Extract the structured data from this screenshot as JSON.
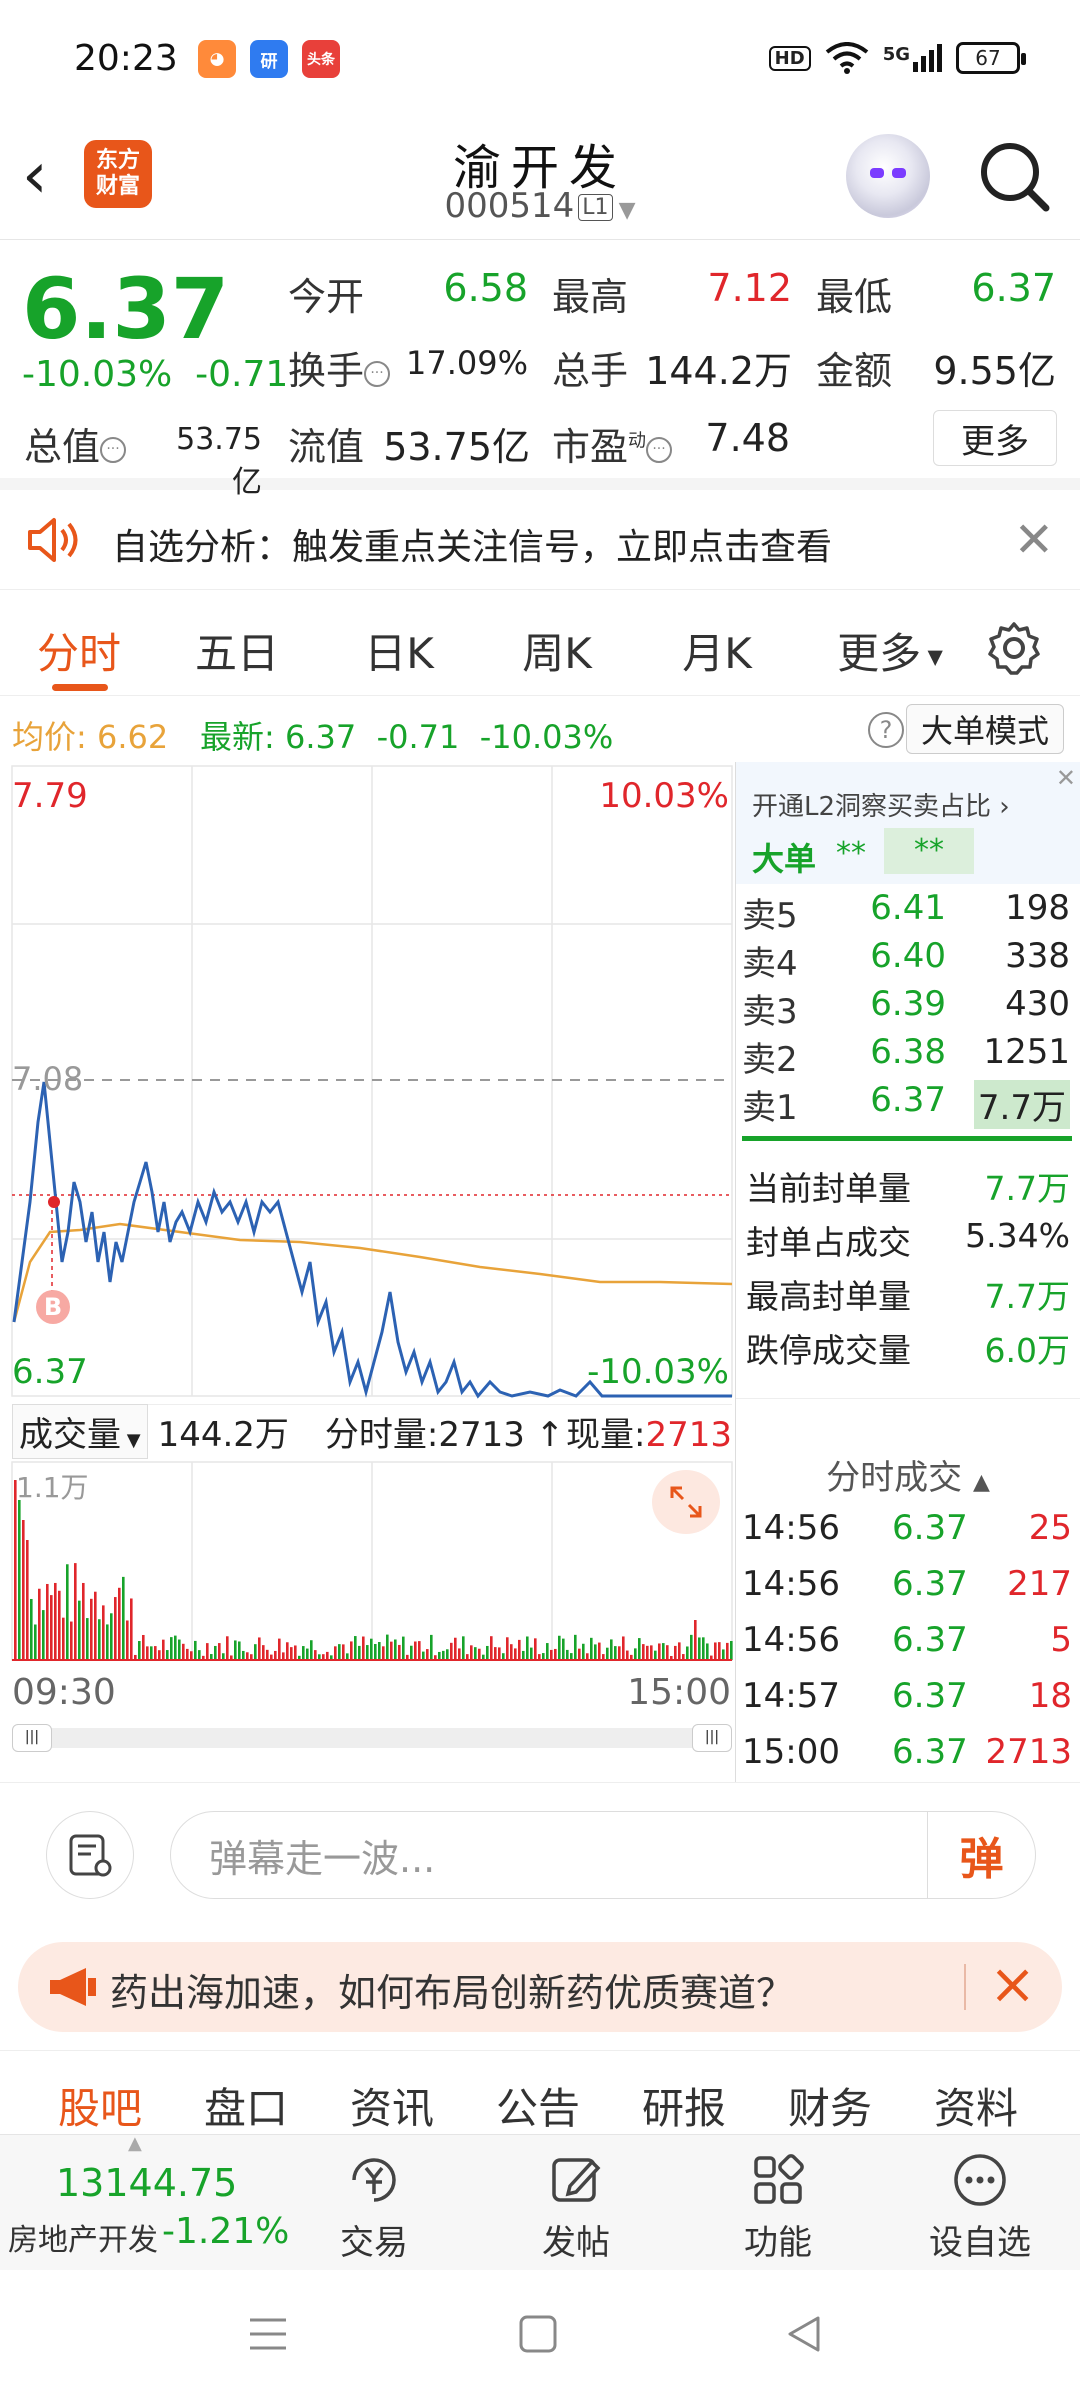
{
  "status_bar": {
    "time": "20:23",
    "network": "5G",
    "hd": "HD",
    "battery": "67",
    "apps": [
      "antuan",
      "研",
      "头条"
    ]
  },
  "header": {
    "logo_line1": "东方",
    "logo_line2": "财富",
    "stock_name": "渝开发",
    "stock_code": "000514",
    "level": "L1"
  },
  "quote": {
    "price": "6.37",
    "change_pct": "-10.03%",
    "change": "-0.71",
    "open_label": "今开",
    "open": "6.58",
    "high_label": "最高",
    "high": "7.12",
    "low_label": "最低",
    "low": "6.37",
    "turnover_label": "换手",
    "turnover": "17.09%",
    "volume_label": "总手",
    "volume": "144.2万",
    "amount_label": "金额",
    "amount": "9.55亿",
    "mcap_label": "总值",
    "mcap": "53.75亿",
    "float_label": "流值",
    "float": "53.75亿",
    "pe_label": "市盈",
    "pe_sup": "动",
    "pe": "7.48",
    "more": "更多"
  },
  "banner": {
    "text": "自选分析：触发重点关注信号，立即点击查看"
  },
  "tabs": [
    "分时",
    "五日",
    "日K",
    "周K",
    "月K",
    "更多"
  ],
  "avg_bar": {
    "avg_label": "均价:",
    "avg": "6.62",
    "latest_label": "最新:",
    "latest": "6.37",
    "chg": "-0.71",
    "pct": "-10.03%",
    "big_mode": "大单模式"
  },
  "chart": {
    "y_top_left": "7.79",
    "y_top_right": "10.03%",
    "y_mid": "7.08",
    "y_bot_left": "6.37",
    "y_bot_right": "-10.03%",
    "marker": "B",
    "vol_label": "成交量",
    "vol_total": "144.2万",
    "tick_label": "分时量:2713",
    "now_label": "现量:",
    "now": "2713",
    "vol_max": "1.1万",
    "x_start": "09:30",
    "x_end": "15:00"
  },
  "orderbook": {
    "promo": "开通L2洞察买卖占比",
    "big_label": "大单",
    "big_v1": "**",
    "big_v2": "**",
    "asks": [
      {
        "label": "卖5",
        "price": "6.41",
        "vol": "198"
      },
      {
        "label": "卖4",
        "price": "6.40",
        "vol": "338"
      },
      {
        "label": "卖3",
        "price": "6.39",
        "vol": "430"
      },
      {
        "label": "卖2",
        "price": "6.38",
        "vol": "1251"
      },
      {
        "label": "卖1",
        "price": "6.37",
        "vol": "7.7万"
      }
    ],
    "seal": [
      {
        "label": "当前封单量",
        "value": "7.7万"
      },
      {
        "label": "封单占成交",
        "value": "5.34%"
      },
      {
        "label": "最高封单量",
        "value": "7.7万"
      },
      {
        "label": "跌停成交量",
        "value": "6.0万"
      }
    ],
    "trades_title": "分时成交",
    "trades": [
      {
        "time": "14:56",
        "price": "6.37",
        "vol": "25"
      },
      {
        "time": "14:56",
        "price": "6.37",
        "vol": "217"
      },
      {
        "time": "14:56",
        "price": "6.37",
        "vol": "5"
      },
      {
        "time": "14:57",
        "price": "6.37",
        "vol": "18"
      },
      {
        "time": "15:00",
        "price": "6.37",
        "vol": "2713"
      }
    ]
  },
  "danmu": {
    "placeholder": "弹幕走一波...",
    "button": "弹"
  },
  "ad": {
    "text": "药出海加速，如何布局创新药优质赛道？"
  },
  "subtabs": [
    "股吧",
    "盘口",
    "资讯",
    "公告",
    "研报",
    "财务",
    "资料"
  ],
  "bottom": {
    "index_value": "13144.75",
    "index_name": "房地产开发",
    "index_pct": "-1.21%",
    "trade": "交易",
    "post": "发帖",
    "func": "功能",
    "watch": "设自选"
  },
  "colors": {
    "up": "#e0262b",
    "down": "#17a32a",
    "accent": "#e8561a",
    "avg_line": "#e8a33a",
    "price_line": "#2c62b3"
  }
}
